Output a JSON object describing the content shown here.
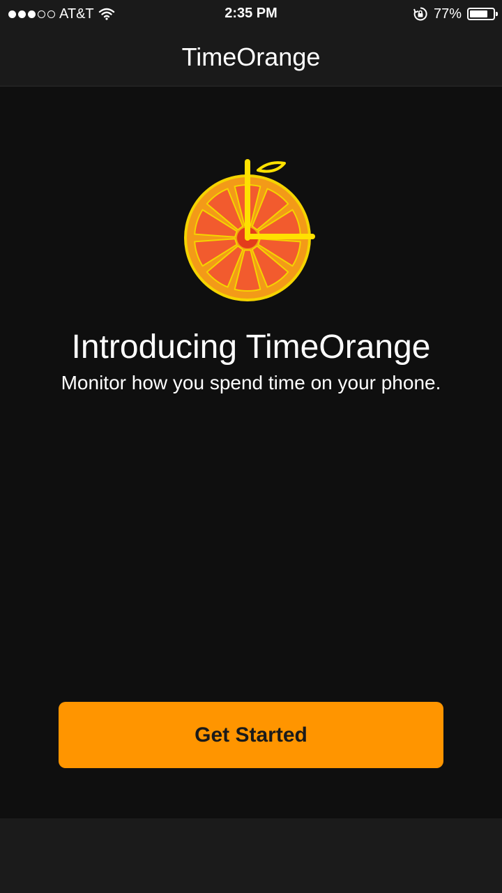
{
  "status_bar": {
    "carrier": "AT&T",
    "time": "2:35 PM",
    "battery_percent": "77%",
    "battery_level": 0.77,
    "signal_bars_filled": 3,
    "signal_bars_total": 5,
    "icons": [
      "signal-dots",
      "wifi",
      "rotation-lock",
      "battery"
    ]
  },
  "nav": {
    "title": "TimeOrange"
  },
  "logo": {
    "icon": "orange-clock",
    "colors": {
      "rim": "#f5d400",
      "peel": "#f39a18",
      "segment": "#f25b2e",
      "center": "#e33d1b",
      "hands": "#ffe100",
      "leaf": "#ffe100"
    }
  },
  "intro": {
    "headline": "Introducing TimeOrange",
    "subhead": "Monitor how you spend time on your phone."
  },
  "cta": {
    "label": "Get Started",
    "color": "#ff9500"
  }
}
